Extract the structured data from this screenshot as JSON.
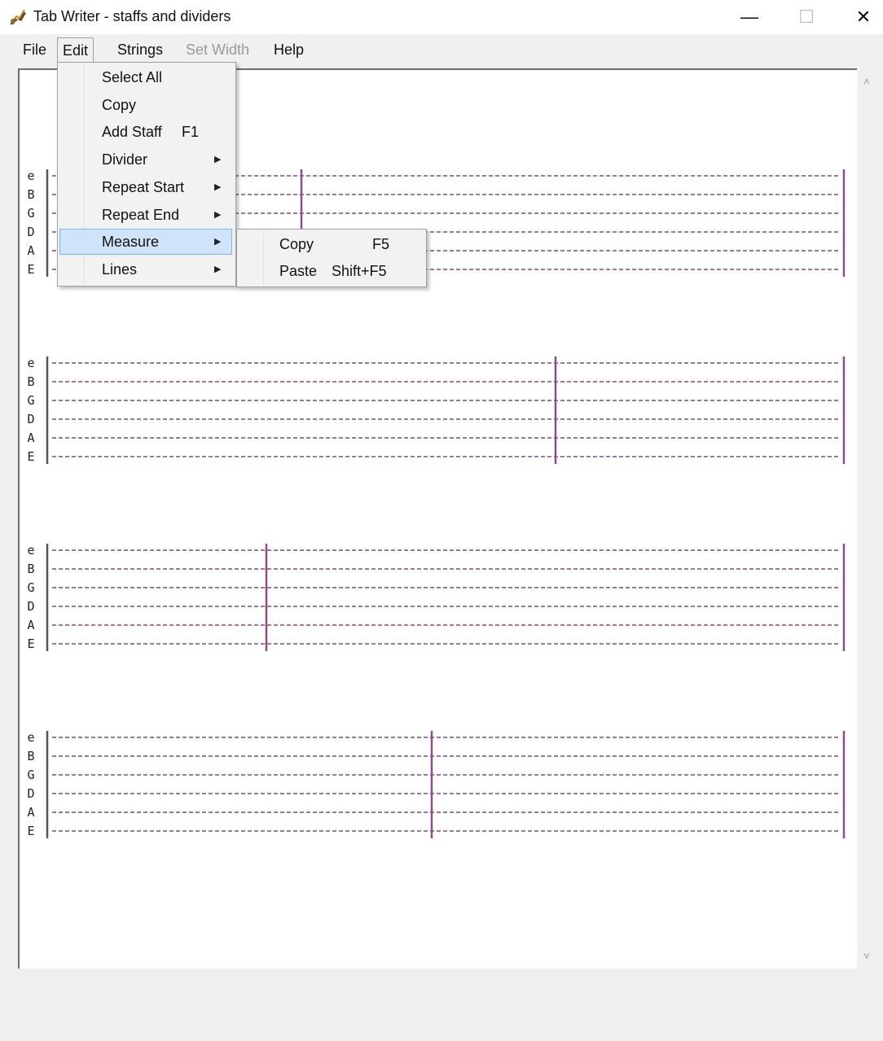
{
  "window": {
    "title": "Tab Writer - staffs and dividers",
    "minimize_glyph": "—",
    "maximize_glyph": "☐",
    "close_glyph": "✕",
    "app_icon": "guitar-icon"
  },
  "menubar": {
    "items": [
      {
        "label": "File",
        "enabled": true
      },
      {
        "label": "Edit",
        "enabled": true,
        "open": true
      },
      {
        "label": "Strings",
        "enabled": true
      },
      {
        "label": "Set Width",
        "enabled": false
      },
      {
        "label": "Help",
        "enabled": true
      }
    ]
  },
  "edit_menu": {
    "items": [
      {
        "label": "Select All",
        "shortcut": "",
        "submenu": false
      },
      {
        "label": "Copy",
        "shortcut": "",
        "submenu": false
      },
      {
        "label": "Add Staff",
        "shortcut": "F1",
        "submenu": false
      },
      {
        "label": "Divider",
        "shortcut": "",
        "submenu": true
      },
      {
        "label": "Repeat Start",
        "shortcut": "",
        "submenu": true
      },
      {
        "label": "Repeat End",
        "shortcut": "",
        "submenu": true
      },
      {
        "label": "Measure",
        "shortcut": "",
        "submenu": true,
        "highlighted": true
      },
      {
        "label": "Lines",
        "shortcut": "",
        "submenu": true
      }
    ]
  },
  "measure_submenu": {
    "items": [
      {
        "label": "Copy",
        "shortcut": "F5"
      },
      {
        "label": "Paste",
        "shortcut": "Shift+F5"
      }
    ]
  },
  "tab": {
    "strings": [
      "e",
      "B",
      "G",
      "D",
      "A",
      "E"
    ],
    "staffs": [
      {
        "measures": 2
      },
      {
        "measures": 2
      },
      {
        "measures": 2
      },
      {
        "measures": 2
      }
    ],
    "line_color": "#7a4a7a",
    "bar_color": "#8b4e8b"
  },
  "scrollbar": {
    "up_glyph": "˄",
    "down_glyph": "˅"
  }
}
